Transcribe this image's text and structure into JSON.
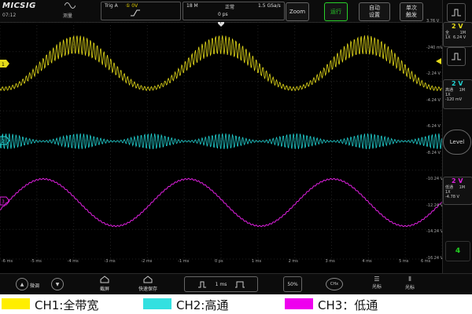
{
  "header": {
    "logo": "MICSIG",
    "time": "07:12",
    "measure_label": "测量",
    "trigger": {
      "label": "Trig A",
      "level": "① 0V"
    },
    "memory_depth": "18 M",
    "acquire_mode": "正常",
    "sample_rate": "1.5 GSa/s",
    "time_position": "0 ps",
    "zoom_label": "Zoom",
    "run_label": "运行",
    "auto_label": "自动\n设置",
    "single_label": "单次\n触发"
  },
  "channels": [
    {
      "id": "1",
      "volts": "2 V",
      "coupling": "全",
      "probe": "1X",
      "impedance": "1M",
      "offset": "6.24 V",
      "color": "#e6dc1a"
    },
    {
      "id": "2",
      "volts": "2 V",
      "coupling": "高通",
      "probe": "1X",
      "impedance": "1M",
      "offset": "-120 mV",
      "color": "#22d3d3"
    },
    {
      "id": "3",
      "volts": "2 V",
      "coupling": "低通",
      "probe": "1X",
      "impedance": "1M",
      "offset": "-4.78 V",
      "color": "#e020e0"
    }
  ],
  "level_label": "Level",
  "ch4_label": "4",
  "y_ticks": [
    "3.76 V",
    "-240 mV",
    "-2.24 V",
    "-4.24 V",
    "-6.24 V",
    "-8.24 V",
    "-10.24 V",
    "-12.24 V",
    "-14.24 V",
    "-16.24 V"
  ],
  "x_ticks": [
    "-6 ms",
    "-5 ms",
    "-4 ms",
    "-3 ms",
    "-2 ms",
    "-1 ms",
    "0 ps",
    "1 ms",
    "2 ms",
    "3 ms",
    "4 ms",
    "5 ms",
    "6 ms"
  ],
  "footer": {
    "fine_label": "微调",
    "screenshot_label": "截屏",
    "quicksave_label": "快速保存",
    "timebase": "1 ms",
    "percent": "50%",
    "ch_button": "CHx",
    "cursor1": "光标",
    "cursor2": "光标"
  },
  "legend": [
    {
      "label": "CH1:全带宽",
      "color": "#ffee00"
    },
    {
      "label": "CH2:高通",
      "color": "#33e0e0"
    },
    {
      "label": "CH3：低通",
      "color": "#ee00ee"
    }
  ]
}
